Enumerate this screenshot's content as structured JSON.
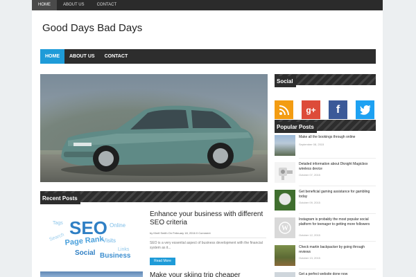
{
  "topbar": {
    "links": [
      {
        "label": "HOME",
        "active": true
      },
      {
        "label": "ABOUT US",
        "active": false
      },
      {
        "label": "CONTACT",
        "active": false
      }
    ]
  },
  "site": {
    "title": "Good Days Bad Days"
  },
  "mainnav": {
    "links": [
      {
        "label": "HOME",
        "active": true
      },
      {
        "label": "ABOUT US",
        "active": false
      },
      {
        "label": "CONTACT",
        "active": false
      }
    ]
  },
  "recent": {
    "heading": "Recent Posts",
    "posts": [
      {
        "title": "Enhance your business with different SEO criteria",
        "meta": "by Khell Smith On February 18, 2016 0 Comment",
        "excerpt": "SEO is a very essential aspect of business development with the financial system as it...",
        "read_more": "Read More",
        "thumb_words": [
          "SEO",
          "Page Rank",
          "Visits",
          "Social",
          "Business",
          "Online",
          "Tags",
          "Search",
          "Links"
        ]
      },
      {
        "title": "Make your skiing trip cheaper"
      }
    ]
  },
  "social": {
    "heading": "Social",
    "icons": [
      {
        "name": "rss",
        "glyph": "◉",
        "color": "#f39c12"
      },
      {
        "name": "google-plus",
        "glyph": "g+",
        "color": "#dd4b39"
      },
      {
        "name": "facebook",
        "glyph": "f",
        "color": "#3b5998"
      },
      {
        "name": "twitter",
        "glyph": "t",
        "color": "#1da1f2"
      }
    ]
  },
  "popular": {
    "heading": "Popular Posts",
    "items": [
      {
        "title": "Make all the bookings through online",
        "date": "September 08, 2015"
      },
      {
        "title": "Detailed information about Dknight Magicbox wireless device",
        "date": "October 07, 2015"
      },
      {
        "title": "Get beneficial gaming assistance for gambling today",
        "date": "October 09, 2015"
      },
      {
        "title": "Instagram is probably the most popular social platform for teenager to getting more followers",
        "date": "October 12, 2015"
      },
      {
        "title": "Check martin backpacker by going through reviews",
        "date": "October 13, 2015"
      },
      {
        "title": "Get a perfect website done now",
        "date": ""
      }
    ]
  },
  "colors": {
    "accent": "#1e9bd8",
    "nav_dark": "#2d2d2d",
    "background": "#eceff1"
  }
}
